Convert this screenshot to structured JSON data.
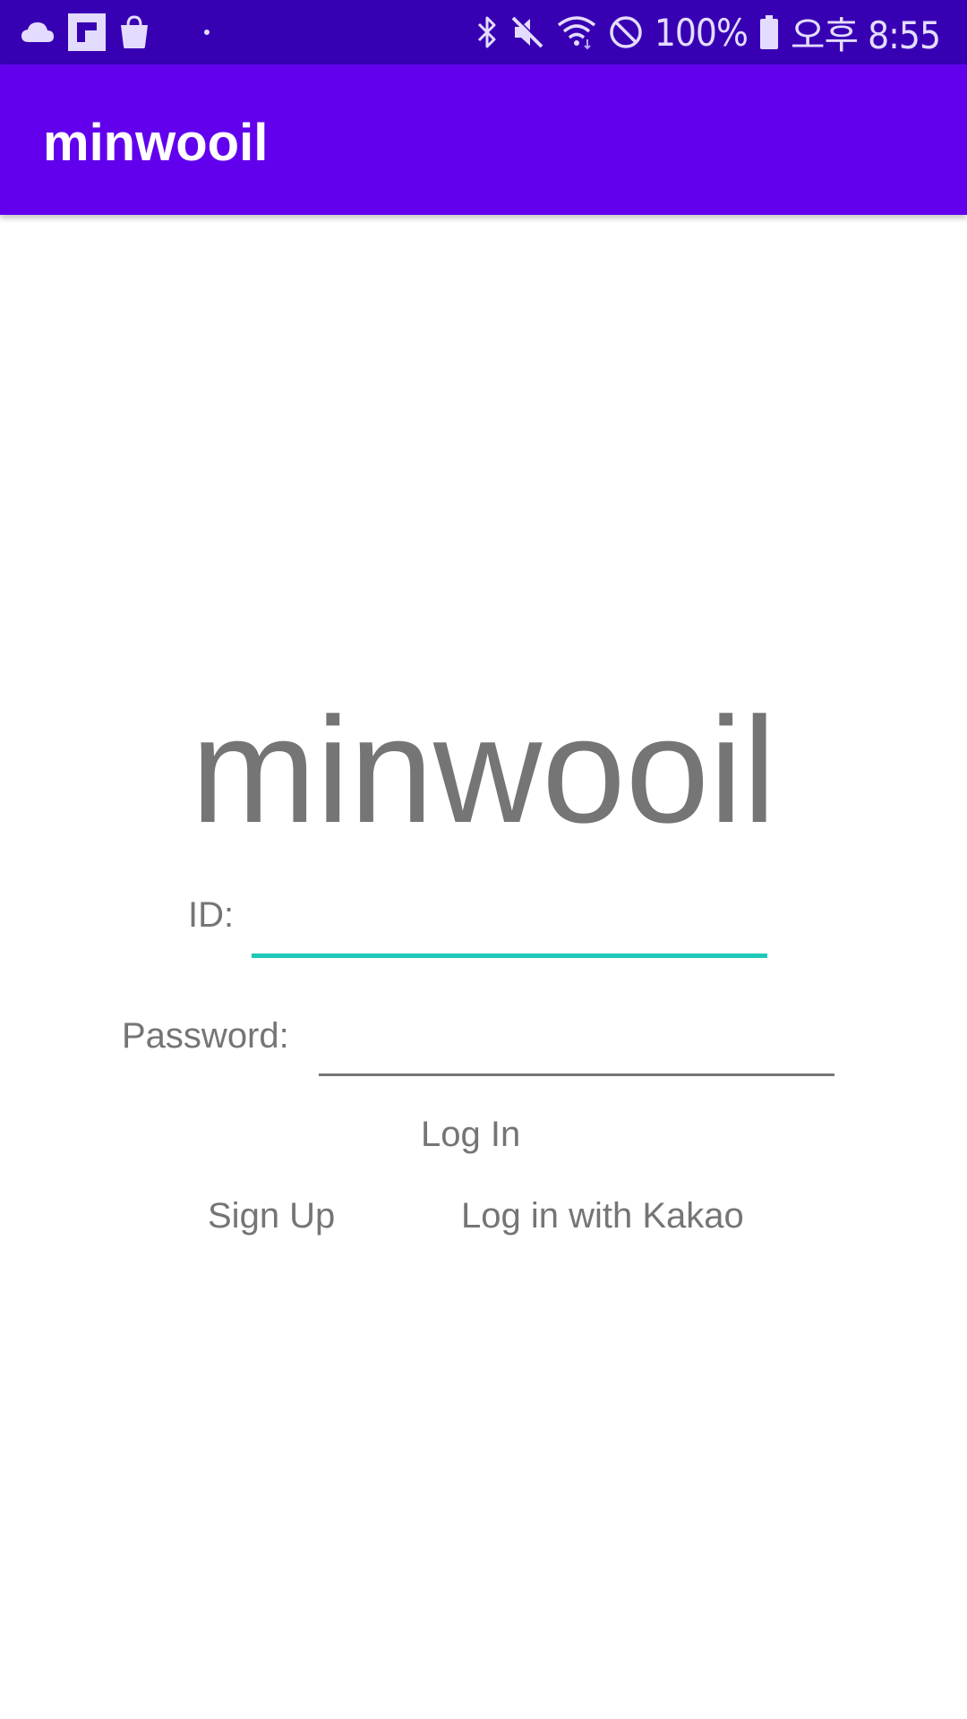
{
  "status_bar": {
    "left_icons": [
      "cloud-icon",
      "flipboard-icon",
      "shopping-bag-icon",
      "dot-icon"
    ],
    "right_icons": [
      "bluetooth-icon",
      "mute-icon",
      "wifi-icon",
      "do-not-disturb-icon",
      "battery-icon"
    ],
    "battery": "100%",
    "time": "오후 8:55",
    "color": "#3700b3"
  },
  "app_bar": {
    "title": "minwooil",
    "color": "#6200ee"
  },
  "login": {
    "brand": "minwooil",
    "id_label": "ID:",
    "id_value": "",
    "password_label": "Password:",
    "password_value": "",
    "login_button": "Log In",
    "signup_button": "Sign Up",
    "kakao_button": "Log in with Kakao",
    "accent_color": "#1ec8b8"
  }
}
